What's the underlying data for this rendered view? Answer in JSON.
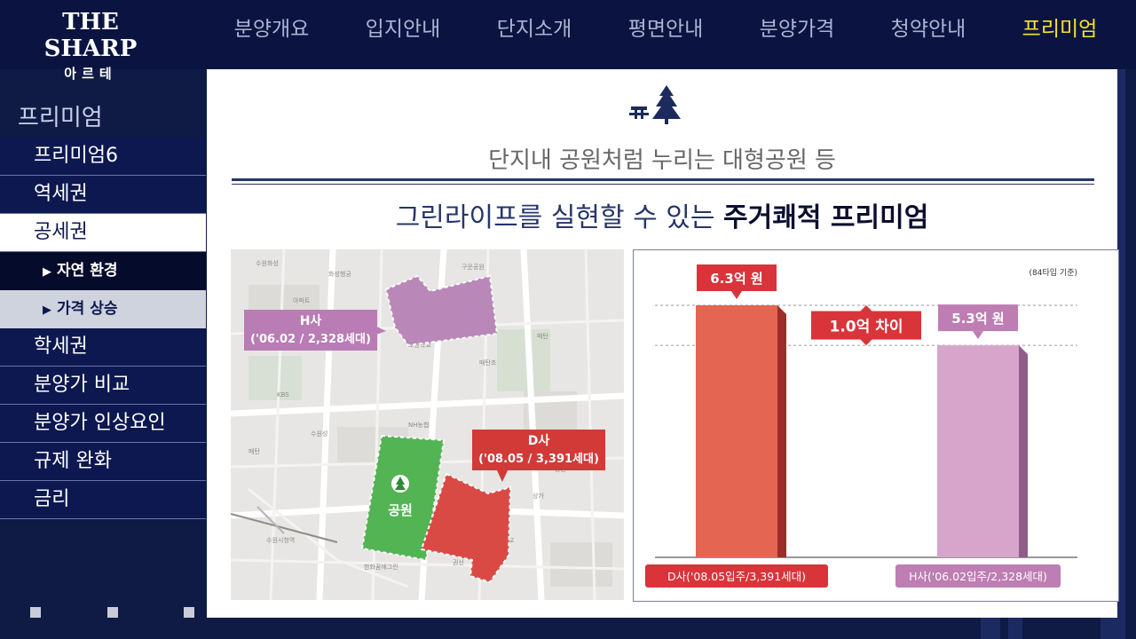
{
  "brand": {
    "name": "THE SHARP",
    "sub": "아르테"
  },
  "nav": [
    "분양개요",
    "입지안내",
    "단지소개",
    "평면안내",
    "분양가격",
    "청약안내",
    "프리미엄"
  ],
  "nav_active_index": 6,
  "side": {
    "title": "프리미엄",
    "items": [
      "프리미엄6",
      "역세권",
      "공세권",
      "학세권",
      "분양가 비교",
      "분양가 인상요인",
      "규제 완화",
      "금리"
    ],
    "active_item": "공세권",
    "subitems": [
      "자연 환경",
      "가격 상승"
    ]
  },
  "content": {
    "subtitle": "단지내 공원처럼 누리는 대형공원 등",
    "headline_normal": "그린라이프를 실현할 수 있는 ",
    "headline_bold": "주거쾌적 프리미엄"
  },
  "map": {
    "callout_h_line1": "H사",
    "callout_h_line2": "('06.02 / 2,328세대)",
    "callout_d_line1": "D사",
    "callout_d_line2": "('08.05 / 3,391세대)",
    "park_label": "공원",
    "colors": {
      "h": "#b57db0",
      "d": "#d83c35",
      "park": "#4aad52"
    }
  },
  "chart_data": {
    "type": "bar",
    "note": "(84타입 기준)",
    "categories": [
      "D사('08.05입주/3,391세대)",
      "H사('06.02입주/2,328세대)"
    ],
    "values": [
      6.3,
      5.3
    ],
    "value_labels": [
      "6.3억 원",
      "5.3억 원"
    ],
    "difference_label": "1.0억 차이",
    "colors": [
      "#e46552",
      "#d7a5cb"
    ],
    "label_colors": [
      "#d8343a",
      "#be7db3"
    ]
  }
}
